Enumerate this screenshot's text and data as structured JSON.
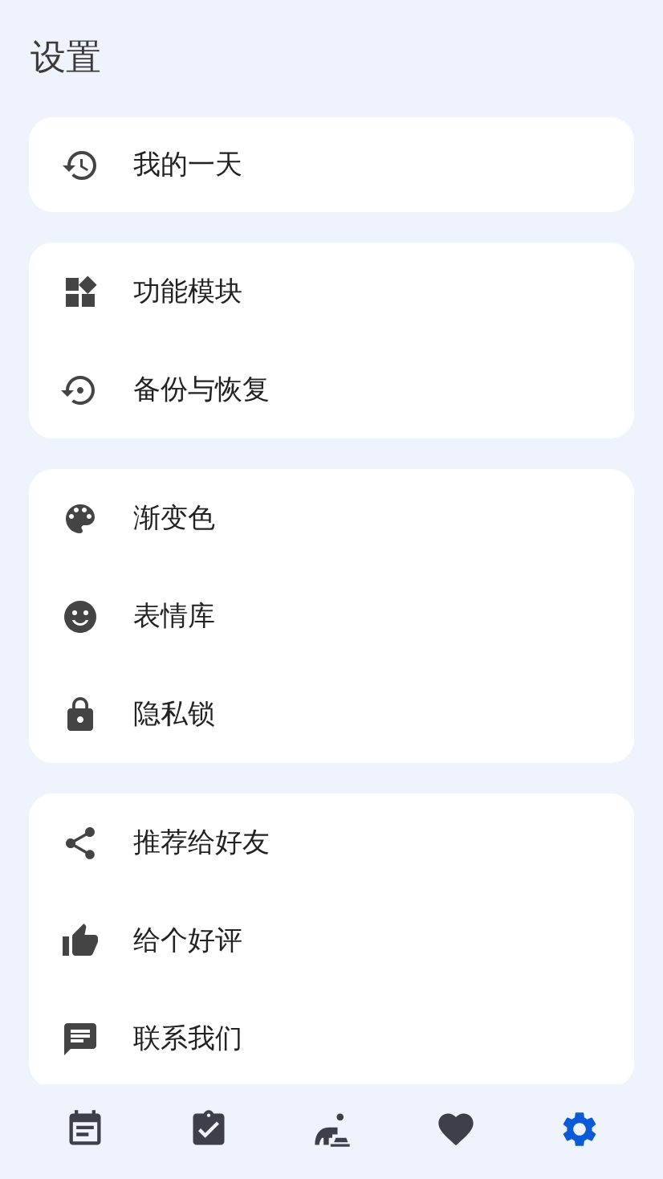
{
  "title": "设置",
  "groups": [
    {
      "items": [
        {
          "label": "我的一天"
        }
      ]
    },
    {
      "items": [
        {
          "label": "功能模块"
        },
        {
          "label": "备份与恢复"
        }
      ]
    },
    {
      "items": [
        {
          "label": "渐变色"
        },
        {
          "label": "表情库"
        },
        {
          "label": "隐私锁"
        }
      ]
    },
    {
      "items": [
        {
          "label": "推荐给好友"
        },
        {
          "label": "给个好评"
        },
        {
          "label": "联系我们"
        }
      ]
    }
  ],
  "bottom_nav": [
    {
      "selected": false
    },
    {
      "selected": false
    },
    {
      "selected": false
    },
    {
      "selected": false
    },
    {
      "selected": true
    }
  ]
}
